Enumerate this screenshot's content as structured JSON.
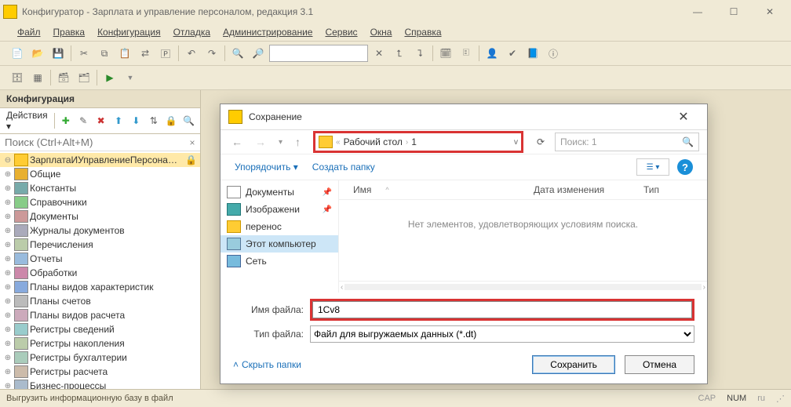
{
  "title": "Конфигуратор - Зарплата и управление персоналом, редакция 3.1",
  "menu": [
    "Файл",
    "Правка",
    "Конфигурация",
    "Отладка",
    "Администрирование",
    "Сервис",
    "Окна",
    "Справка"
  ],
  "sidebar": {
    "title": "Конфигурация",
    "actions_label": "Действия",
    "search_placeholder": "Поиск (Ctrl+Alt+M)",
    "root": "ЗарплатаИУправлениеПерсонал...",
    "items": [
      "Общие",
      "Константы",
      "Справочники",
      "Документы",
      "Журналы документов",
      "Перечисления",
      "Отчеты",
      "Обработки",
      "Планы видов характеристик",
      "Планы счетов",
      "Планы видов расчета",
      "Регистры сведений",
      "Регистры накопления",
      "Регистры бухгалтерии",
      "Регистры расчета",
      "Бизнес-процессы"
    ]
  },
  "dialog": {
    "title": "Сохранение",
    "path_parts": [
      "Рабочий стол",
      "1"
    ],
    "search_placeholder": "Поиск: 1",
    "organize": "Упорядочить",
    "new_folder": "Создать папку",
    "columns": {
      "name": "Имя",
      "date": "Дата изменения",
      "type": "Тип"
    },
    "empty_text": "Нет элементов, удовлетворяющих условиям поиска.",
    "places": [
      {
        "label": "Документы",
        "pinned": true,
        "icon": "doc"
      },
      {
        "label": "Изображени",
        "pinned": true,
        "icon": "img"
      },
      {
        "label": "перенос",
        "pinned": false,
        "icon": "folder"
      },
      {
        "label": "Этот компьютер",
        "pinned": false,
        "icon": "pc",
        "selected": true
      },
      {
        "label": "Сеть",
        "pinned": false,
        "icon": "net"
      }
    ],
    "filename_label": "Имя файла:",
    "filename_value": "1Cv8",
    "filetype_label": "Тип файла:",
    "filetype_value": "Файл для выгружаемых данных (*.dt)",
    "hide_folders": "Скрыть папки",
    "save": "Сохранить",
    "cancel": "Отмена"
  },
  "statusbar": {
    "text": "Выгрузить информационную базу в файл",
    "cap": "CAP",
    "num": "NUM",
    "lang": "ru"
  }
}
